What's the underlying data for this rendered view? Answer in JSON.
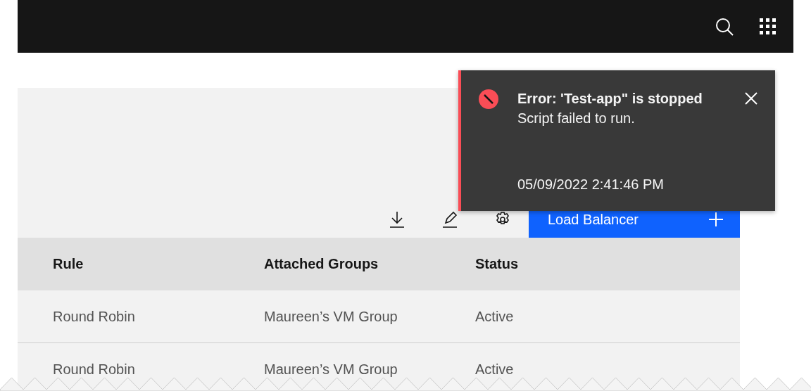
{
  "toolbar": {
    "primary_button": {
      "label": "Load Balancer"
    }
  },
  "table": {
    "columns": [
      "Rule",
      "Attached Groups",
      "Status"
    ],
    "rows": [
      [
        "Round Robin",
        "Maureen’s VM Group",
        "Active"
      ],
      [
        "Round Robin",
        "Maureen’s VM Group",
        "Active"
      ]
    ]
  },
  "notification": {
    "kind": "error",
    "title": "Error: 'Test-app\" is stopped",
    "subtitle": "Script failed to run.",
    "caption": "05/09/2022 2:41:46 PM"
  }
}
